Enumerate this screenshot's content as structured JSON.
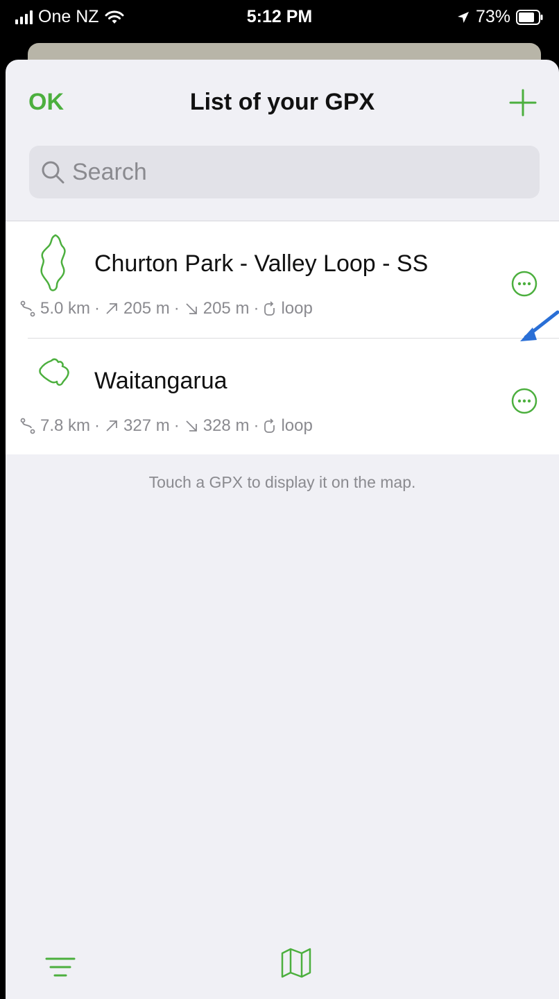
{
  "status_bar": {
    "carrier": "One NZ",
    "time": "5:12 PM",
    "battery": "73%"
  },
  "nav": {
    "ok_label": "OK",
    "title": "List of your GPX"
  },
  "search": {
    "placeholder": "Search",
    "value": ""
  },
  "tracks": [
    {
      "name": "Churton Park - Valley Loop - SS",
      "distance": "5.0 km",
      "ascent": "205 m",
      "descent": "205 m",
      "type": "loop"
    },
    {
      "name": "Waitangarua",
      "distance": "7.8 km",
      "ascent": "327 m",
      "descent": "328 m",
      "type": "loop"
    }
  ],
  "hint": "Touch a GPX to display it on the map.",
  "colors": {
    "accent": "#4caf3e",
    "annotation": "#2a6fd6"
  }
}
